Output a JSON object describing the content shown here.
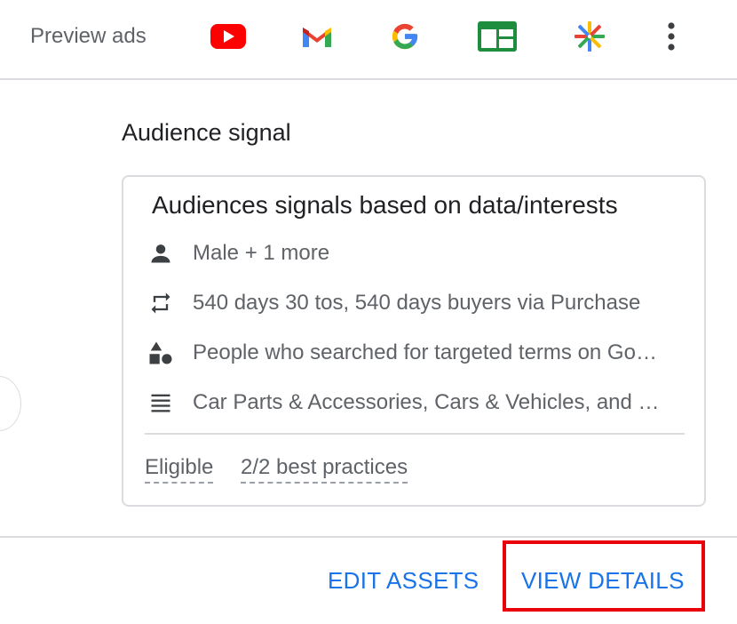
{
  "header": {
    "preview_label": "Preview ads",
    "icons": [
      "youtube-icon",
      "gmail-icon",
      "google-icon",
      "display-network-icon",
      "discover-icon",
      "more-vert-icon"
    ]
  },
  "section": {
    "title": "Audience signal"
  },
  "card": {
    "title": "Audiences signals based on data/interests",
    "rows": [
      {
        "icon": "person-icon",
        "text": "Male + 1 more"
      },
      {
        "icon": "repeat-icon",
        "text": "540 days 30 tos, 540 days buyers via Purchase"
      },
      {
        "icon": "shapes-icon",
        "text": "People who searched for targeted terms on Google"
      },
      {
        "icon": "list-icon",
        "text": "Car Parts & Accessories, Cars & Vehicles, and more"
      }
    ],
    "status": "Eligible",
    "best_practices": "2/2 best practices"
  },
  "footer": {
    "edit_label": "EDIT ASSETS",
    "view_label": "VIEW DETAILS"
  },
  "colors": {
    "accent": "#1a73e8",
    "highlight": "#e8000b",
    "text_secondary": "#5f6368",
    "border": "#dadce0"
  }
}
